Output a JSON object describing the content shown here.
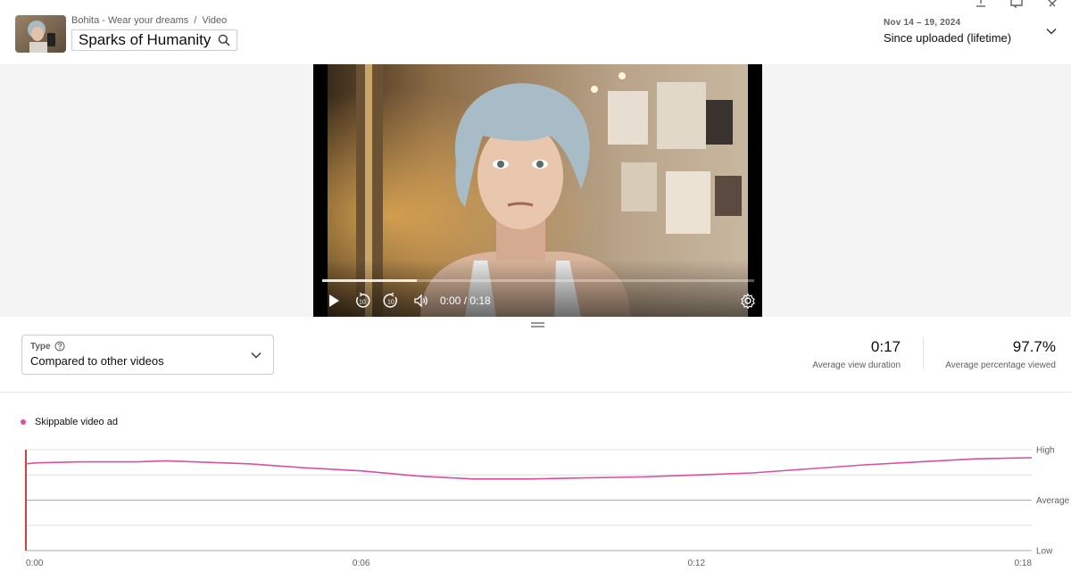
{
  "header": {
    "channel": "Bohita - Wear your dreams",
    "separator": "/",
    "section": "Video",
    "video_title": "Sparks of Humanity",
    "date_range": "Nov 14 – 19, 2024",
    "period_label": "Since uploaded (lifetime)"
  },
  "player": {
    "time_display": "0:00 / 0:18",
    "progress": 0.22
  },
  "type_selector": {
    "label": "Type",
    "value": "Compared to other videos"
  },
  "metrics": [
    {
      "value": "0:17",
      "label": "Average view duration"
    },
    {
      "value": "97.7%",
      "label": "Average percentage viewed"
    }
  ],
  "legend": {
    "series_name": "Skippable video ad",
    "color": "#d94fa3"
  },
  "chart_data": {
    "type": "line",
    "x_labels": [
      "0:00",
      "0:06",
      "0:12",
      "0:18"
    ],
    "y_labels": [
      "High",
      "Average",
      "Low"
    ],
    "xlim": [
      0,
      18
    ],
    "ylim": [
      0,
      1
    ],
    "series": [
      {
        "name": "Skippable video ad",
        "color": "#d94fa3",
        "x": [
          0,
          0.2,
          1,
          2,
          2.5,
          3,
          4,
          5,
          6,
          7,
          8,
          9,
          10,
          11,
          12,
          13,
          14,
          15,
          16,
          17,
          18
        ],
        "y": [
          0.86,
          0.87,
          0.88,
          0.88,
          0.89,
          0.88,
          0.86,
          0.82,
          0.79,
          0.74,
          0.71,
          0.71,
          0.72,
          0.73,
          0.75,
          0.77,
          0.81,
          0.85,
          0.88,
          0.91,
          0.92
        ]
      }
    ]
  }
}
